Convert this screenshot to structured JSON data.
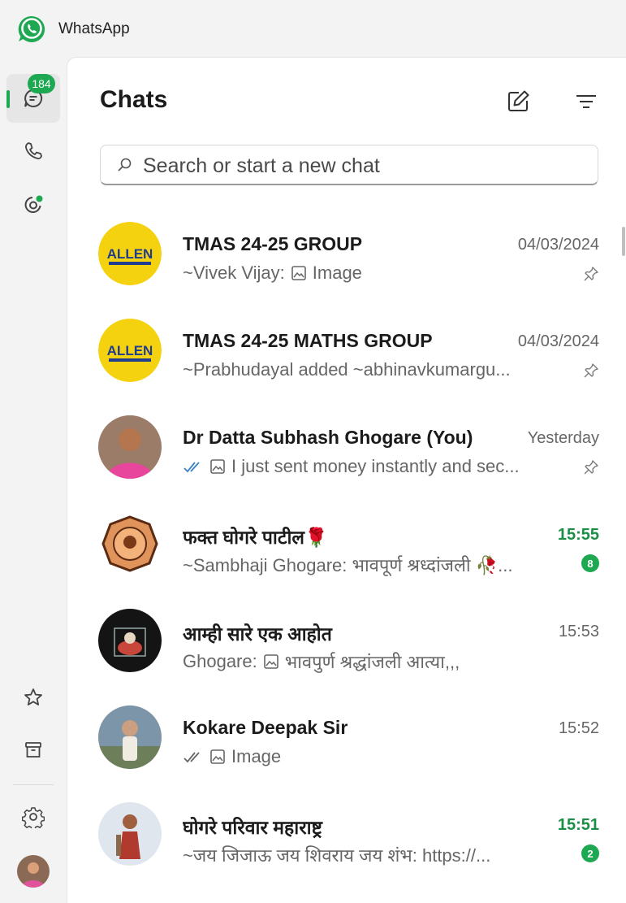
{
  "app": {
    "title": "WhatsApp"
  },
  "rail": {
    "chats_badge": "184",
    "colors": {
      "accent": "#1da851"
    }
  },
  "panel": {
    "title": "Chats",
    "new_chat_icon": "new-chat-icon",
    "filter_icon": "filter-icon"
  },
  "search": {
    "placeholder": "Search or start a new chat"
  },
  "chats": [
    {
      "name": "TMAS 24-25 GROUP",
      "time": "04/03/2024",
      "sender": "~Vivek Vijay: ",
      "preview": "Image",
      "pinned": true
    },
    {
      "name": "TMAS 24-25 MATHS GROUP",
      "time": "04/03/2024",
      "preview": "~Prabhudayal added ~abhinavkumargu...",
      "pinned": true
    },
    {
      "name": "Dr Datta Subhash Ghogare (You)",
      "time": "Yesterday",
      "preview": "I just sent money instantly and sec...",
      "pinned": true
    },
    {
      "name": "फक्त घोगरे पाटील🌹",
      "time": "15:55",
      "preview": "~Sambhaji Ghogare: भावपूर्ण श्रध्दांजली 🥀...",
      "unread": "8"
    },
    {
      "name": "आम्ही सारे एक आहोत",
      "time": "15:53",
      "sender": "Ghogare: ",
      "preview": "भावपुर्ण श्रद्धांजली आत्या,,,"
    },
    {
      "name": "Kokare Deepak Sir",
      "time": "15:52",
      "preview": "Image"
    },
    {
      "name": "घोगरे परिवार महाराष्ट्र",
      "time": "15:51",
      "preview": "~जय जिजाऊ जय शिवराय जय शंभ: https://...",
      "unread": "2"
    }
  ]
}
